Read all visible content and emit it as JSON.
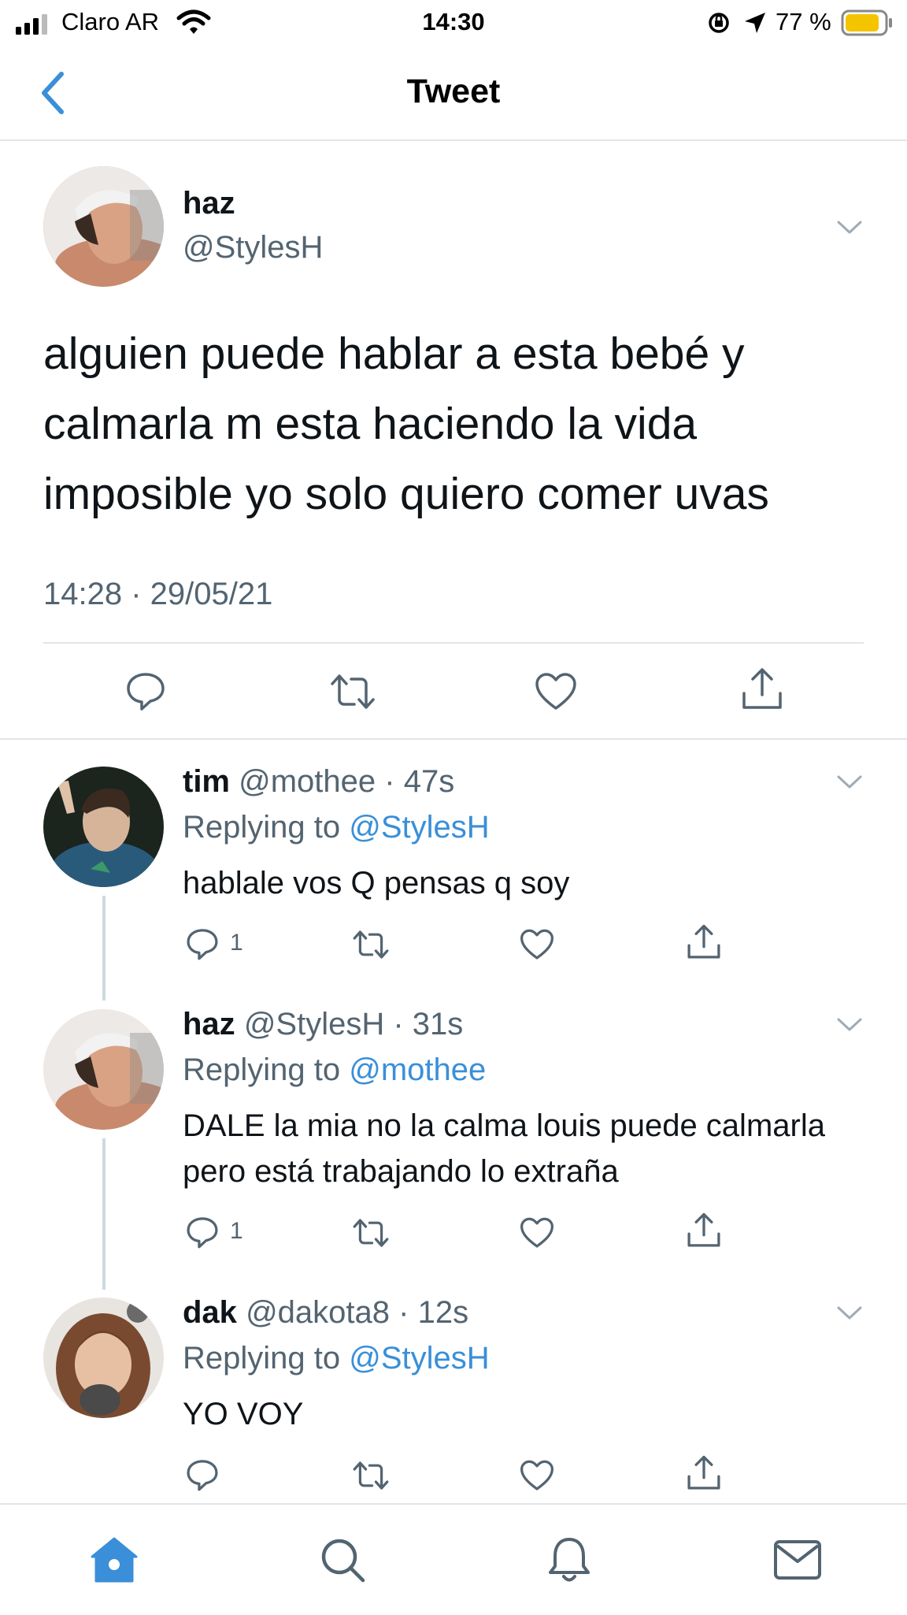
{
  "status_bar": {
    "carrier": "Claro AR",
    "time": "14:30",
    "battery_percent": "77 %"
  },
  "nav": {
    "title": "Tweet",
    "back_icon": "chevron-left-icon"
  },
  "tweet": {
    "name": "haz",
    "handle": "@StylesH",
    "text": "alguien puede hablar a esta bebé y calmarla m esta haciendo la vida imposible yo solo quiero comer uvas",
    "timestamp": "14:28 · 29/05/21"
  },
  "replies": [
    {
      "name": "tim",
      "handle": "@mothee",
      "time": "· 47s",
      "replying_label": "Replying to",
      "replying_to": "@StylesH",
      "text": "hablale vos Q pensas q soy",
      "reply_count": "1"
    },
    {
      "name": "haz",
      "handle": "@StylesH",
      "time": "· 31s",
      "replying_label": "Replying to",
      "replying_to": "@mothee",
      "text": "DALE la mia no la calma louis puede calmarla pero está trabajando lo extraña",
      "reply_count": "1"
    },
    {
      "name": "dak",
      "handle": "@dakota8",
      "time": "· 12s",
      "replying_label": "Replying to",
      "replying_to": "@StylesH",
      "text": "YO VOY",
      "reply_count": ""
    }
  ],
  "tab_bar": [
    "home-icon",
    "search-icon",
    "notifications-icon",
    "messages-icon"
  ],
  "colors": {
    "accent": "#3a8fd8",
    "secondary_text": "#536471",
    "battery": "#f5c400",
    "divider": "#e1e6ea"
  }
}
